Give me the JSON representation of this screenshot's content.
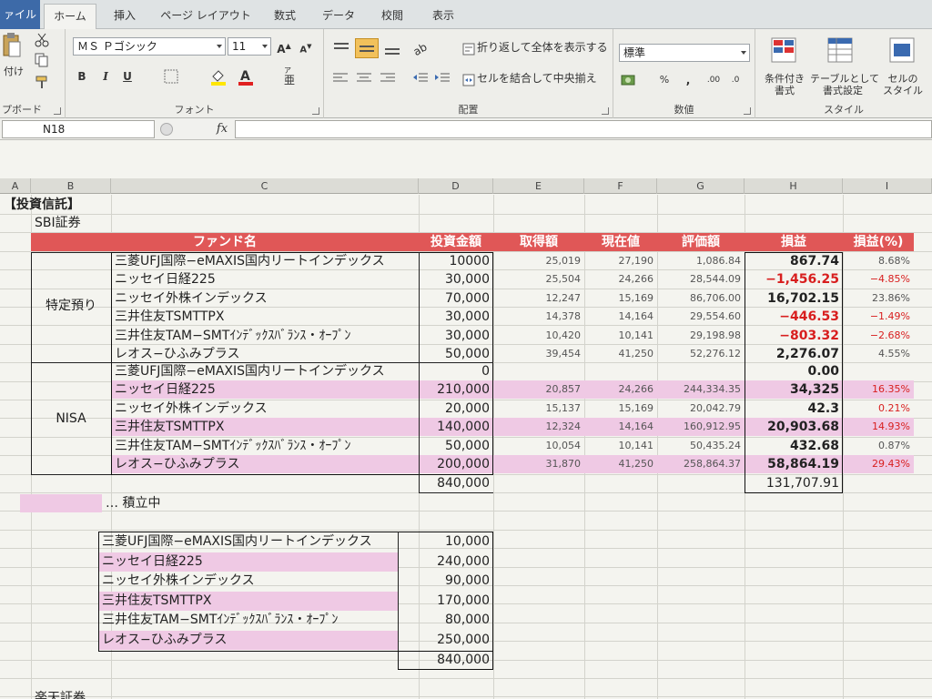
{
  "tabs": [
    "ァイル",
    "ホーム",
    "挿入",
    "ページ レイアウト",
    "数式",
    "データ",
    "校閲",
    "表示"
  ],
  "ribbon": {
    "clipboard_paste": "付け",
    "clipboard_label": "プボード",
    "font_name": "ＭＳ Ｐゴシック",
    "font_size": "11",
    "font_label": "フォント",
    "wrap_text": "折り返して全体を表示する",
    "merge_center": "セルを結合して中央揃え",
    "align_label": "配置",
    "number_format": "標準",
    "number_label": "数値",
    "cond_format": "条件付き\n書式",
    "table_format": "テーブルとして\n書式設定",
    "cell_style": "セルの\nスタイル",
    "style_label": "スタイル"
  },
  "formula_bar": {
    "name_box": "N18",
    "fx": "fx"
  },
  "columns": [
    "A",
    "B",
    "C",
    "D",
    "E",
    "F",
    "G",
    "H",
    "I"
  ],
  "title": "【投資信託】",
  "broker": "SBI証券",
  "table_headers": [
    "ファンド名",
    "投資金額",
    "取得額",
    "現在値",
    "評価額",
    "損益",
    "損益(%)"
  ],
  "group_tokutei": "特定預り",
  "group_nisa": "NISA",
  "tokutei_rows": [
    {
      "name": "三菱UFJ国際−eMAXIS国内リートインデックス",
      "amount": "10000",
      "cost": "25,019",
      "price": "27,190",
      "value": "1,086.84",
      "pl": "867.74",
      "pct": "8.68%",
      "neg": false
    },
    {
      "name": "ニッセイ日経225",
      "amount": "30,000",
      "cost": "25,504",
      "price": "24,266",
      "value": "28,544.09",
      "pl": "−1,456.25",
      "pct": "−4.85%",
      "neg": true
    },
    {
      "name": "ニッセイ外株インデックス",
      "amount": "70,000",
      "cost": "12,247",
      "price": "15,169",
      "value": "86,706.00",
      "pl": "16,702.15",
      "pct": "23.86%",
      "neg": false
    },
    {
      "name": "三井住友TSMTTPX",
      "amount": "30,000",
      "cost": "14,378",
      "price": "14,164",
      "value": "29,554.60",
      "pl": "−446.53",
      "pct": "−1.49%",
      "neg": true
    },
    {
      "name": "三井住友TAM−SMTｲﾝﾃﾞｯｸｽﾊﾞﾗﾝｽ・ｵｰﾌﾟﾝ",
      "amount": "30,000",
      "cost": "10,420",
      "price": "10,141",
      "value": "29,198.98",
      "pl": "−803.32",
      "pct": "−2.68%",
      "neg": true
    },
    {
      "name": "レオス−ひふみプラス",
      "amount": "50,000",
      "cost": "39,454",
      "price": "41,250",
      "value": "52,276.12",
      "pl": "2,276.07",
      "pct": "4.55%",
      "neg": false
    }
  ],
  "nisa_rows": [
    {
      "name": "三菱UFJ国際−eMAXIS国内リートインデックス",
      "amount": "0",
      "cost": "",
      "price": "",
      "value": "",
      "pl": "0.00",
      "pct": "",
      "pink": false
    },
    {
      "name": "ニッセイ日経225",
      "amount": "210,000",
      "cost": "20,857",
      "price": "24,266",
      "value": "244,334.35",
      "pl": "34,325",
      "pct": "16.35%",
      "pink": true
    },
    {
      "name": "ニッセイ外株インデックス",
      "amount": "20,000",
      "cost": "15,137",
      "price": "15,169",
      "value": "20,042.79",
      "pl": "42.3",
      "pct": "0.21%",
      "pink": false
    },
    {
      "name": "三井住友TSMTTPX",
      "amount": "140,000",
      "cost": "12,324",
      "price": "14,164",
      "value": "160,912.95",
      "pl": "20,903.68",
      "pct": "14.93%",
      "pink": true
    },
    {
      "name": "三井住友TAM−SMTｲﾝﾃﾞｯｸｽﾊﾞﾗﾝｽ・ｵｰﾌﾟﾝ",
      "amount": "50,000",
      "cost": "10,054",
      "price": "10,141",
      "value": "50,435.24",
      "pl": "432.68",
      "pct": "0.87%",
      "pink": false
    },
    {
      "name": "レオス−ひふみプラス",
      "amount": "200,000",
      "cost": "31,870",
      "price": "41,250",
      "value": "258,864.37",
      "pl": "58,864.19",
      "pct": "29.43%",
      "pink": true
    }
  ],
  "total_amount": "840,000",
  "total_pl": "131,707.91",
  "legend_text": "… 積立中",
  "summary_rows": [
    {
      "name": "三菱UFJ国際−eMAXIS国内リートインデックス",
      "amount": "10,000",
      "pink": false
    },
    {
      "name": "ニッセイ日経225",
      "amount": "240,000",
      "pink": true
    },
    {
      "name": "ニッセイ外株インデックス",
      "amount": "90,000",
      "pink": false
    },
    {
      "name": "三井住友TSMTTPX",
      "amount": "170,000",
      "pink": true
    },
    {
      "name": "三井住友TAM−SMTｲﾝﾃﾞｯｸｽﾊﾞﾗﾝｽ・ｵｰﾌﾟﾝ",
      "amount": "80,000",
      "pink": false
    },
    {
      "name": "レオス−ひふみプラス",
      "amount": "250,000",
      "pink": true
    }
  ],
  "summary_total": "840,000",
  "next_broker": "楽天証券",
  "colors": {
    "header_red": "#e05757",
    "pink": "#efc9e4",
    "negative": "#d81e1e",
    "file_tab": "#3d6aa8"
  }
}
